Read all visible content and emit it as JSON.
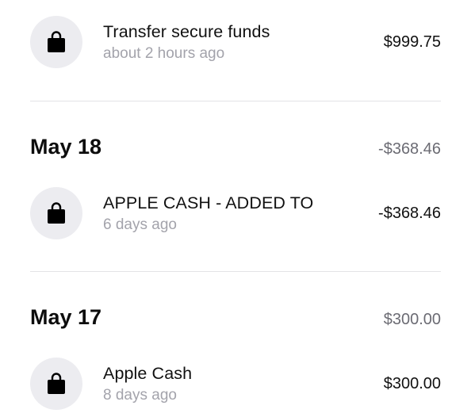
{
  "transactions_top": [
    {
      "title": "Transfer secure funds",
      "time": "about 2 hours ago",
      "amount": "$999.75",
      "icon": "shopping-bag-icon"
    }
  ],
  "days": [
    {
      "date": "May 18",
      "total": "-$368.46",
      "transactions": [
        {
          "title": "APPLE CASH - ADDED TO",
          "time": "6 days ago",
          "amount": "-$368.46",
          "icon": "shopping-bag-icon"
        }
      ]
    },
    {
      "date": "May 17",
      "total": "$300.00",
      "transactions": [
        {
          "title": "Apple Cash",
          "time": "8 days ago",
          "amount": "$300.00",
          "icon": "shopping-bag-icon"
        }
      ]
    }
  ],
  "colors": {
    "icon_background": "#ececf0",
    "secondary_text": "#a3a3ab",
    "day_total_text": "#6b6b73",
    "divider": "#e3e3e6"
  }
}
